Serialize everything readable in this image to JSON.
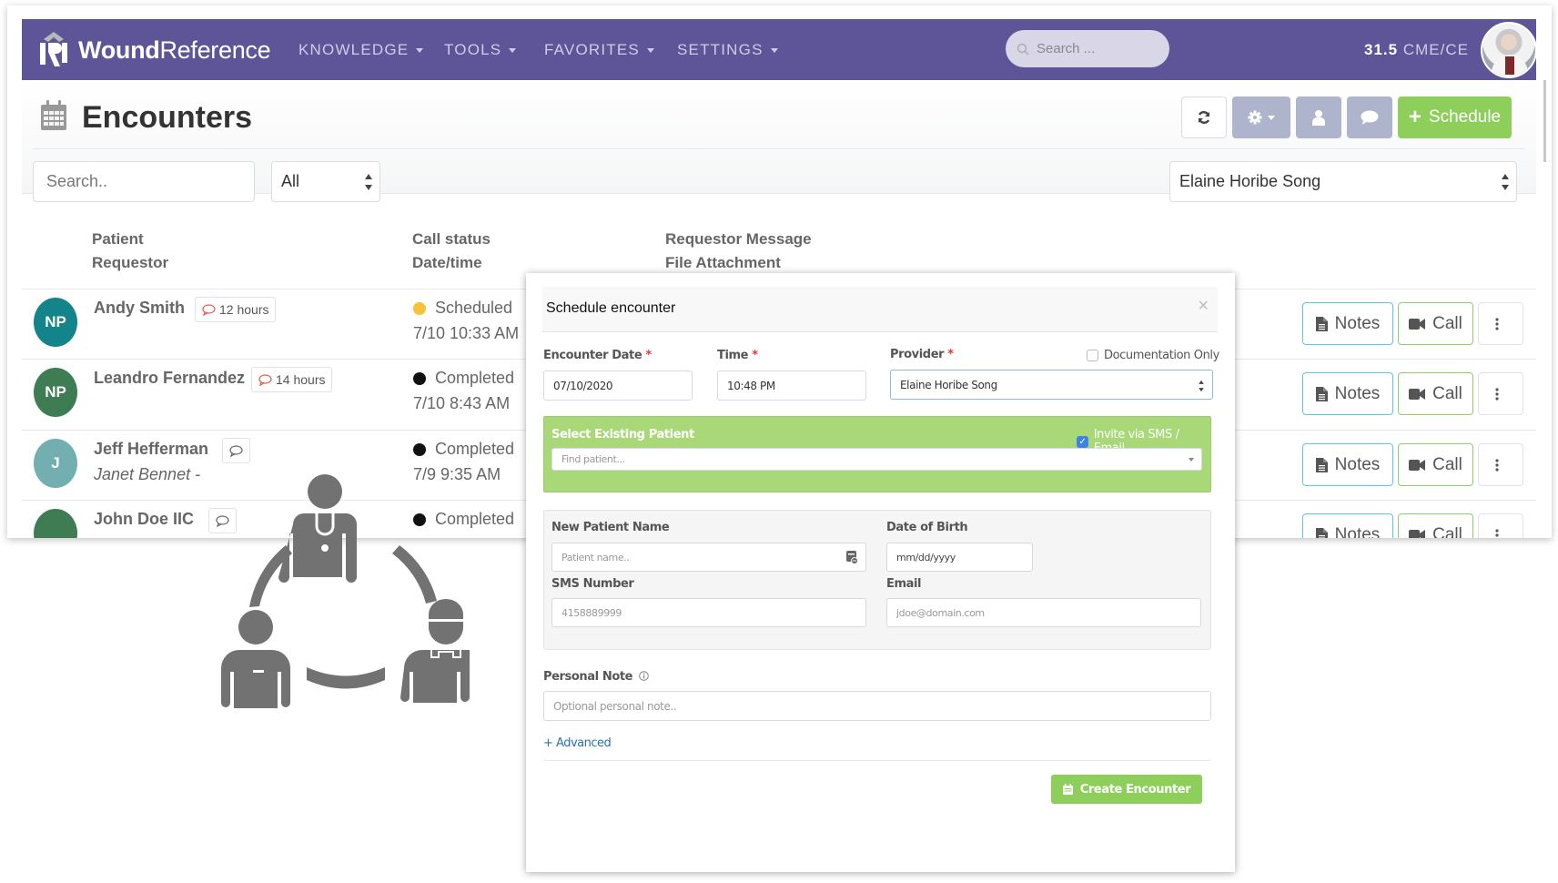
{
  "navbar": {
    "brand_bold": "Wound",
    "brand_rest": "Reference",
    "menu": [
      "KNOWLEDGE",
      "TOOLS",
      "FAVORITES",
      "SETTINGS"
    ],
    "search_placeholder": "Search ...",
    "cme_value": "31.5",
    "cme_label": "CME/CE"
  },
  "header": {
    "title": "Encounters",
    "schedule_label": "Schedule",
    "search_placeholder": "Search..",
    "filter_value": "All",
    "provider_value": "Elaine Horibe Song"
  },
  "columns": {
    "patient": "Patient",
    "requestor": "Requestor",
    "call_status": "Call status",
    "datetime": "Date/time",
    "requestor_message": "Requestor Message",
    "file_attachment": "File Attachment"
  },
  "rows": [
    {
      "initials": "NP",
      "avatar_color": "#13848a",
      "name": "Andy Smith",
      "requestor": "",
      "badge": "12 hours",
      "status": "Scheduled",
      "status_color": "#f5c23a",
      "datetime": "7/10 10:33 AM"
    },
    {
      "initials": "NP",
      "avatar_color": "#3e7d54",
      "name": "Leandro Fernandez",
      "requestor": "",
      "badge": "14 hours",
      "status": "Completed",
      "status_color": "#111111",
      "datetime": "7/10 8:43 AM"
    },
    {
      "initials": "J",
      "avatar_color": "#73aeb1",
      "name": "Jeff Hefferman",
      "requestor": "Janet Bennet -",
      "badge": "",
      "status": "Completed",
      "status_color": "#111111",
      "datetime": "7/9 9:35 AM"
    },
    {
      "initials": "",
      "avatar_color": "#3e7d54",
      "name": "John Doe IIC",
      "requestor": "",
      "badge": "",
      "status": "Completed",
      "status_color": "#111111",
      "datetime": ""
    }
  ],
  "row_actions": {
    "notes": "Notes",
    "call": "Call"
  },
  "modal": {
    "title": "Schedule encounter",
    "close": "×",
    "encounter_date_label": "Encounter Date",
    "encounter_date_value": "07/10/2020",
    "time_label": "Time",
    "time_value": "10:48 PM",
    "provider_label": "Provider",
    "provider_value": "Elaine Horibe Song",
    "documentation_only_label": "Documentation Only",
    "documentation_only_checked": false,
    "required_mark": "*",
    "select_existing_label": "Select Existing Patient",
    "invite_label": "Invite via SMS / Email",
    "invite_checked": true,
    "find_patient_placeholder": "Find patient...",
    "new_patient_name_label": "New Patient Name",
    "patient_name_placeholder": "Patient name..",
    "dob_label": "Date of Birth",
    "dob_placeholder": "mm/dd/yyyy",
    "sms_label": "SMS Number",
    "sms_placeholder": "4158889999",
    "email_label": "Email",
    "email_placeholder": "jdoe@domain.com",
    "personal_note_label": "Personal Note",
    "personal_note_placeholder": "Optional personal note..",
    "advanced_link": "+ Advanced",
    "create_button": "Create Encounter"
  }
}
